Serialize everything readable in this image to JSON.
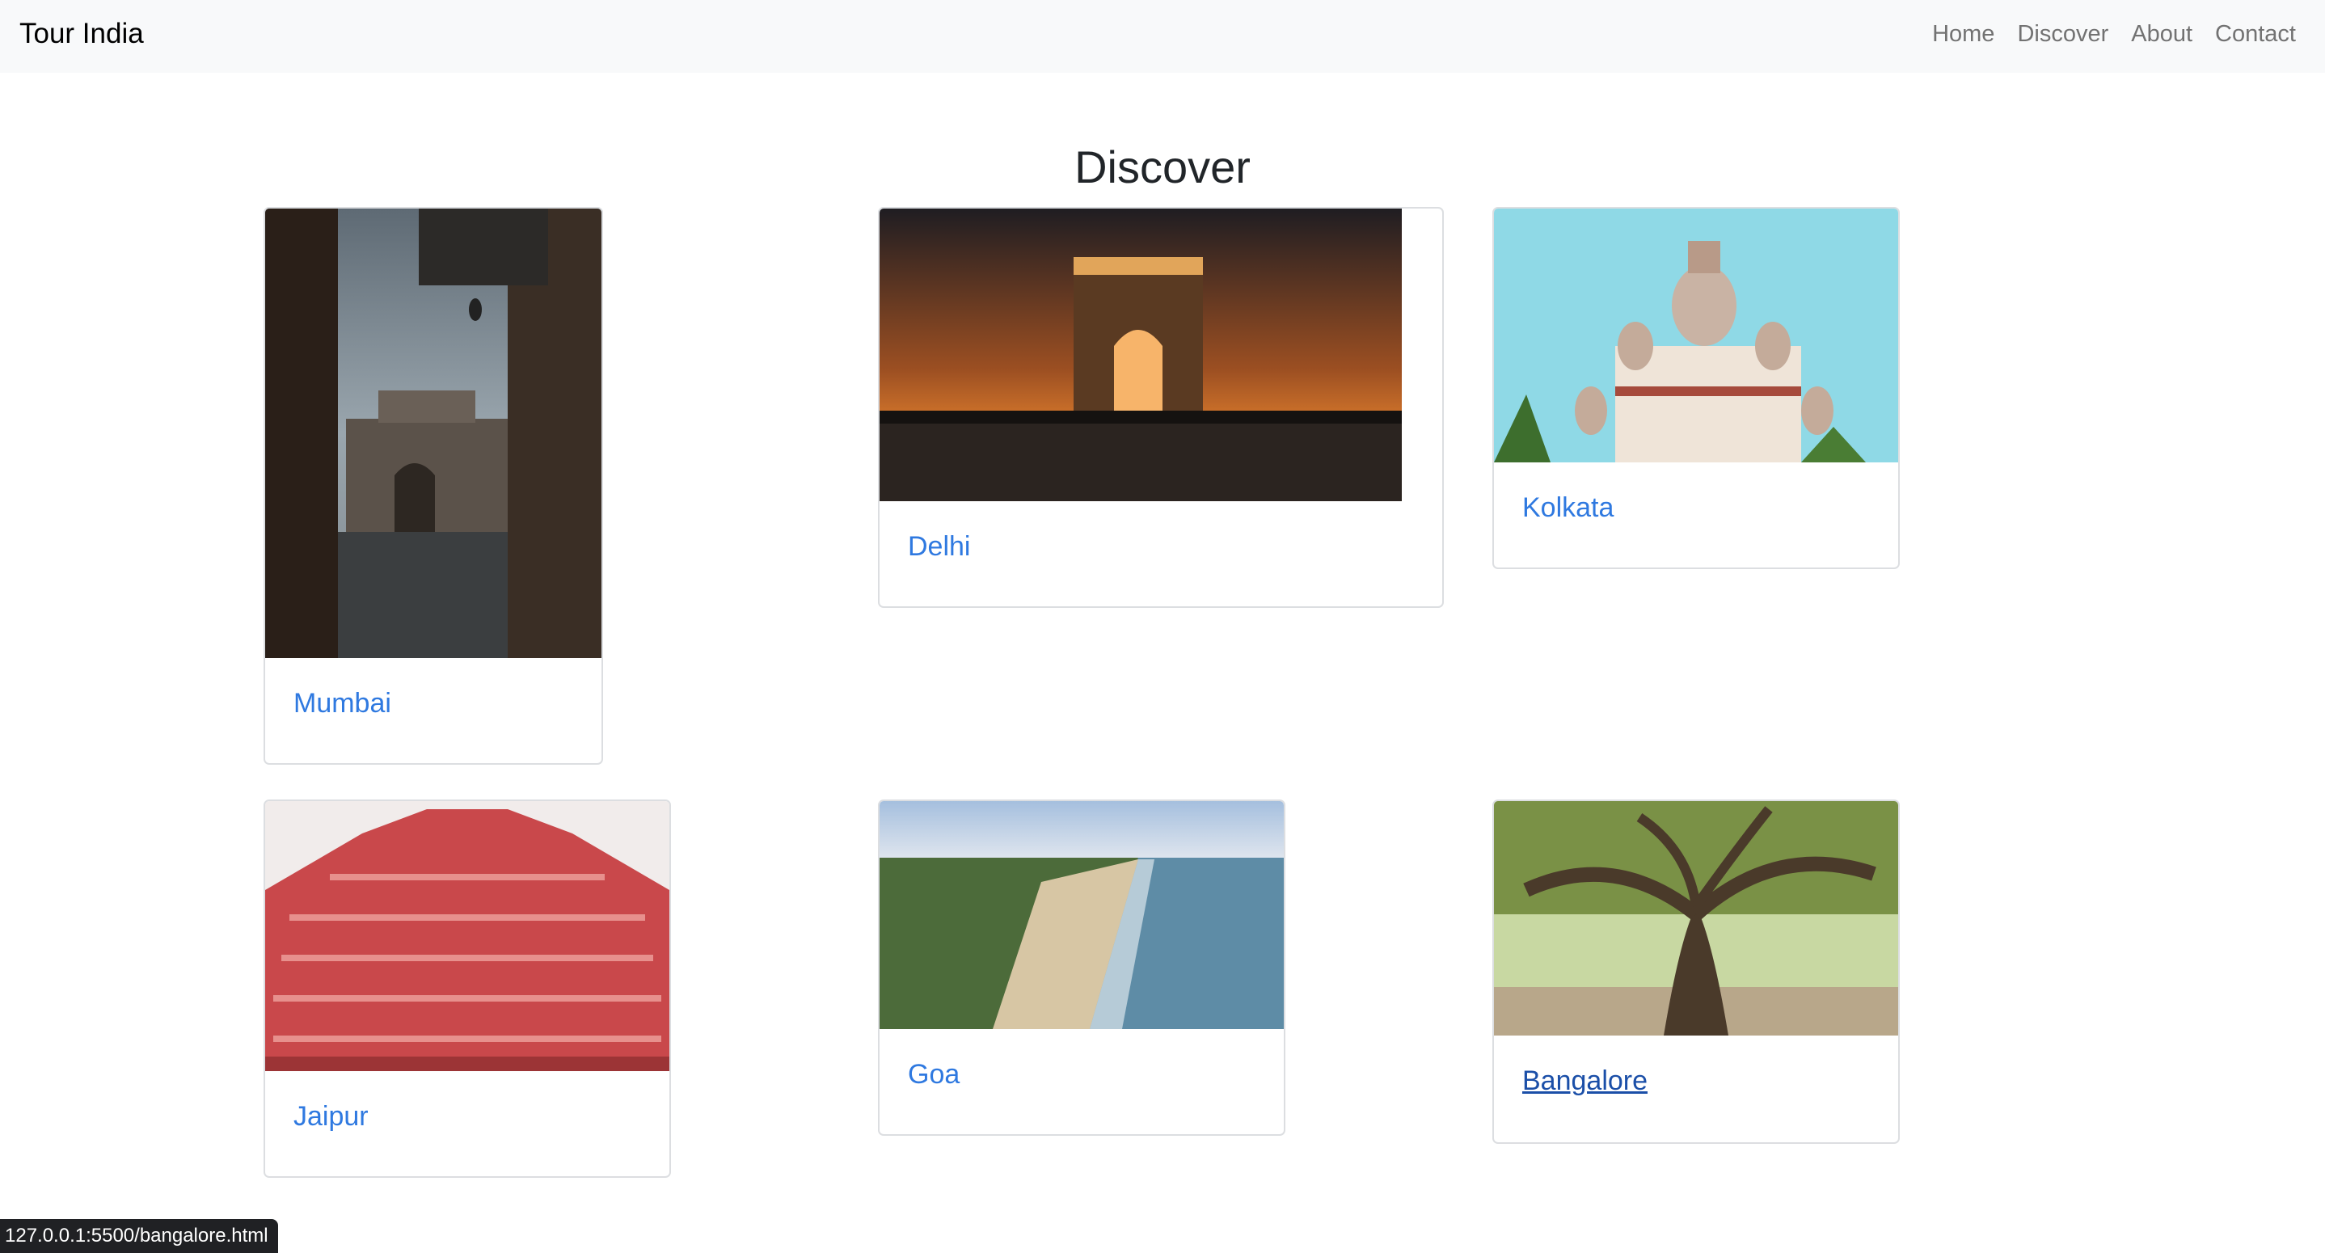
{
  "navbar": {
    "brand": "Tour India",
    "links": [
      "Home",
      "Discover",
      "About",
      "Contact"
    ]
  },
  "page": {
    "title": "Discover"
  },
  "cards": [
    {
      "title": "Mumbai",
      "image": "gateway-of-india-photo"
    },
    {
      "title": "Delhi",
      "image": "india-gate-photo"
    },
    {
      "title": "Kolkata",
      "image": "dakshineswar-temple-photo"
    },
    {
      "title": "Jaipur",
      "image": "hawa-mahal-photo"
    },
    {
      "title": "Goa",
      "image": "beach-coastline-photo"
    },
    {
      "title": "Bangalore",
      "image": "banyan-tree-photo"
    }
  ],
  "status_bar": {
    "url": "127.0.0.1:5500/bangalore.html"
  },
  "colors": {
    "navbar_bg": "#f8f9fa",
    "link": "#2f79e0",
    "link_hover": "#1b4fa8",
    "card_border": "#dcdee1"
  }
}
